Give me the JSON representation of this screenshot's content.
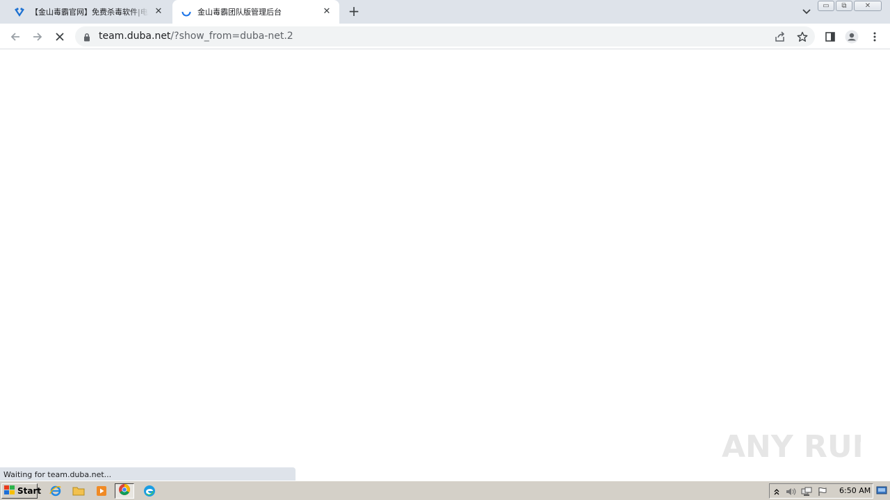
{
  "tabs": [
    {
      "title": "【金山毒霸官网】免费杀毒软件|电脑杀毒",
      "close_label": "✕"
    },
    {
      "title": "金山毒霸团队版管理后台",
      "close_label": "✕"
    }
  ],
  "new_tab_label": "+",
  "window_controls": {
    "minimize": "▭",
    "restore": "⧉",
    "close": "✕"
  },
  "address": {
    "host": "team.duba.net",
    "path": "/?show_from=duba-net.2"
  },
  "status_bubble": "Waiting for team.duba.net...",
  "watermark_text": "ANY RUN",
  "taskbar": {
    "start_label": "Start",
    "clock": "6:50 AM"
  },
  "colors": {
    "tab_strip": "#dee3ea",
    "accent_blue": "#1a73e8",
    "taskbar": "#d4d0c8"
  }
}
